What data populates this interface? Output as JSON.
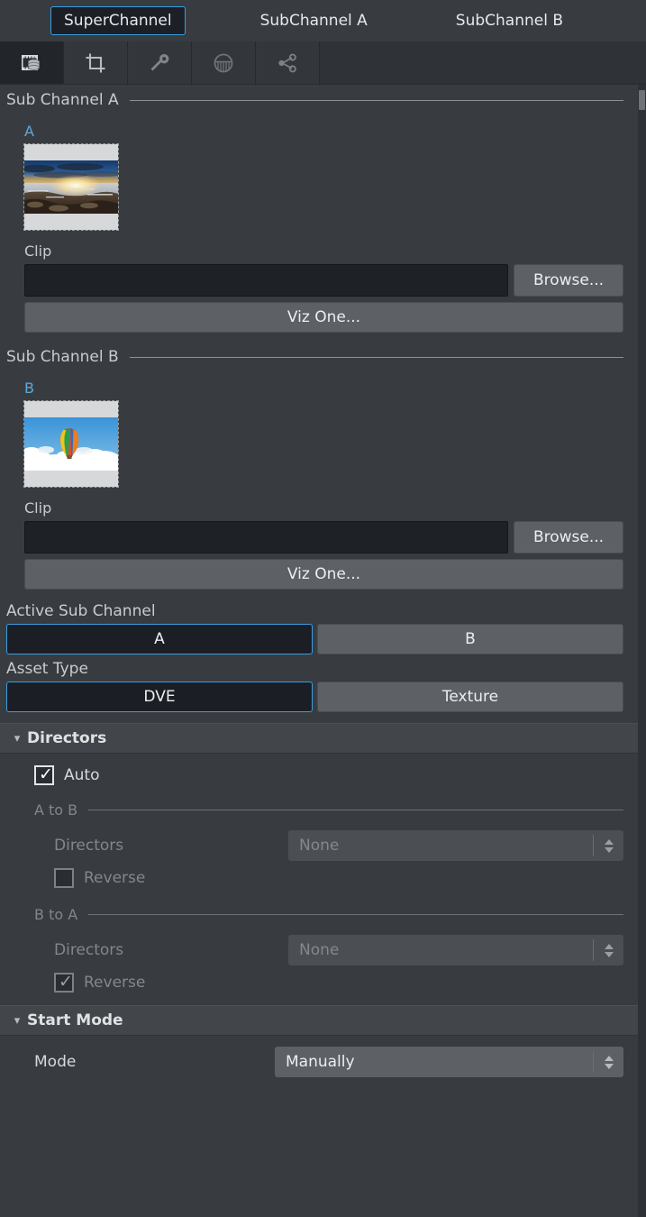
{
  "top_tabs": [
    {
      "label": "SuperChannel",
      "selected": true
    },
    {
      "label": "SubChannel A",
      "selected": false
    },
    {
      "label": "SubChannel B",
      "selected": false
    }
  ],
  "icon_tabs": [
    {
      "name": "media-database-icon",
      "selected": true
    },
    {
      "name": "crop-icon",
      "selected": false
    },
    {
      "name": "key-icon",
      "selected": false
    },
    {
      "name": "dome-basket-icon",
      "selected": false
    },
    {
      "name": "share-nodes-icon",
      "selected": false
    }
  ],
  "sub_channel_a": {
    "header": "Sub Channel A",
    "letter": "A",
    "clip_label": "Clip",
    "clip_value": "",
    "browse_label": "Browse...",
    "vizone_label": "Viz One..."
  },
  "sub_channel_b": {
    "header": "Sub Channel B",
    "letter": "B",
    "clip_label": "Clip",
    "clip_value": "",
    "browse_label": "Browse...",
    "vizone_label": "Viz One..."
  },
  "active_sub_channel": {
    "label": "Active Sub Channel",
    "options": [
      {
        "label": "A",
        "selected": true
      },
      {
        "label": "B",
        "selected": false
      }
    ]
  },
  "asset_type": {
    "label": "Asset Type",
    "options": [
      {
        "label": "DVE",
        "selected": true
      },
      {
        "label": "Texture",
        "selected": false
      }
    ]
  },
  "directors": {
    "section_title": "Directors",
    "expanded": true,
    "auto": {
      "label": "Auto",
      "checked": true
    },
    "a_to_b": {
      "header": "A to B",
      "directors_label": "Directors",
      "directors_value": "None",
      "reverse": {
        "label": "Reverse",
        "checked": false,
        "enabled": false
      }
    },
    "b_to_a": {
      "header": "B to A",
      "directors_label": "Directors",
      "directors_value": "None",
      "reverse": {
        "label": "Reverse",
        "checked": true,
        "enabled": false
      }
    }
  },
  "start_mode": {
    "section_title": "Start Mode",
    "expanded": true,
    "mode_label": "Mode",
    "mode_value": "Manually"
  },
  "colors": {
    "accent": "#3a9de0",
    "background": "#383c40",
    "panel": "#2f3337",
    "input": "#1e2125",
    "button": "#5d6165",
    "letter": "#5fa8dd"
  }
}
